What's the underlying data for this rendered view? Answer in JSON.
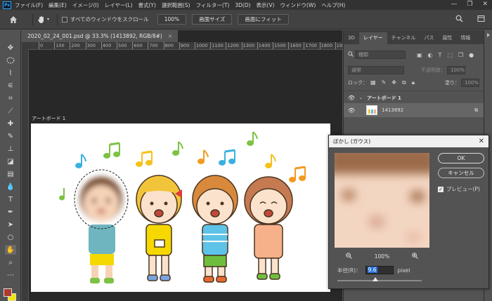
{
  "app": {
    "logo_text": "Ps"
  },
  "menubar": {
    "items": [
      "ファイル(F)",
      "編集(E)",
      "イメージ(I)",
      "レイヤー(L)",
      "書式(Y)",
      "選択範囲(S)",
      "フィルター(T)",
      "3D(D)",
      "表示(V)",
      "ウィンドウ(W)",
      "ヘルプ(H)"
    ],
    "window_controls": [
      "—",
      "❐",
      "✕"
    ]
  },
  "optionsbar": {
    "scroll_all_label": "すべてのウィンドウをスクロール",
    "zoom_value": "100%",
    "fit_screen_label": "画面サイズ",
    "fill_screen_label": "画面にフィット"
  },
  "document": {
    "tab_title": "2020_02_24_001.psd @ 33.3% (1413892, RGB/8#)",
    "tab_close": "×",
    "artboard_label": "アートボード 1",
    "ruler_numbers": [
      "0",
      "100",
      "200",
      "300",
      "400",
      "500",
      "600",
      "700",
      "800",
      "900",
      "1000",
      "1100",
      "1200",
      "1300",
      "1400",
      "1500",
      "1600",
      "1700",
      "1800",
      "1900"
    ]
  },
  "layers_panel": {
    "tabs": [
      "3D",
      "レイヤー",
      "チャンネル",
      "パス",
      "属性",
      "情報"
    ],
    "active_tab": "レイヤー",
    "filter_placeholder": "種類",
    "blend_mode": "通常",
    "opacity_label": "不透明度：",
    "opacity_value": "100%",
    "lock_label": "ロック：",
    "fill_label": "塗り：",
    "fill_value": "100%",
    "layers": [
      {
        "name": "アートボード 1",
        "type": "artboard"
      },
      {
        "name": "1413892",
        "type": "layer"
      }
    ]
  },
  "dialog": {
    "title": "ぼかし (ガウス)",
    "ok_label": "OK",
    "cancel_label": "キャンセル",
    "preview_label": "プレビュー(P)",
    "preview_checked": true,
    "zoom_value": "100%",
    "radius_label": "半径(R)：",
    "radius_value": "9.6",
    "radius_unit": "pixel",
    "radius_slider_fraction": 0.45
  },
  "colors": {
    "foreground": "#b03a2e",
    "background": "#f5e600",
    "accent": "#31a8ff"
  }
}
